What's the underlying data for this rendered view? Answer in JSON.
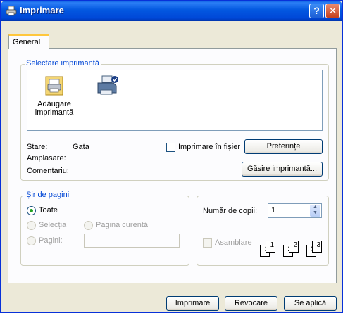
{
  "window": {
    "title": "Imprimare",
    "help_glyph": "?",
    "close_glyph": "✕"
  },
  "tabs": [
    {
      "label": "General"
    }
  ],
  "printer_group": {
    "label": "Selectare imprimantă",
    "items": [
      {
        "label_line1": "Adăugare",
        "label_line2": "imprimantă",
        "icon": "add-printer-icon"
      },
      {
        "label_line1": "",
        "label_line2": "",
        "icon": "printer-icon"
      }
    ]
  },
  "status": {
    "stare_label": "Stare:",
    "stare_value": "Gata",
    "amplasare_label": "Amplasare:",
    "comentariu_label": "Comentariu:"
  },
  "print_to_file": {
    "label": "Imprimare în fișier",
    "checked": false
  },
  "buttons": {
    "preferences": "Preferințe",
    "find_printer": "Găsire imprimantă...",
    "print": "Imprimare",
    "cancel": "Revocare",
    "apply": "Se aplică"
  },
  "page_range": {
    "label": "Șir de pagini",
    "all": "Toate",
    "selection": "Selecția",
    "current_page": "Pagina curentă",
    "pages": "Pagini:",
    "pages_value": "",
    "selected": "all"
  },
  "copies": {
    "label": "Număr de copii:",
    "value": "1",
    "collate_label": "Asamblare",
    "collate_checked": false,
    "collate_pages": [
      "1",
      "1",
      "2",
      "2",
      "3",
      "3"
    ]
  },
  "colors": {
    "title_bar": "#0358e0",
    "group_label": "#0046d5",
    "radio_selected": "#21a121"
  }
}
